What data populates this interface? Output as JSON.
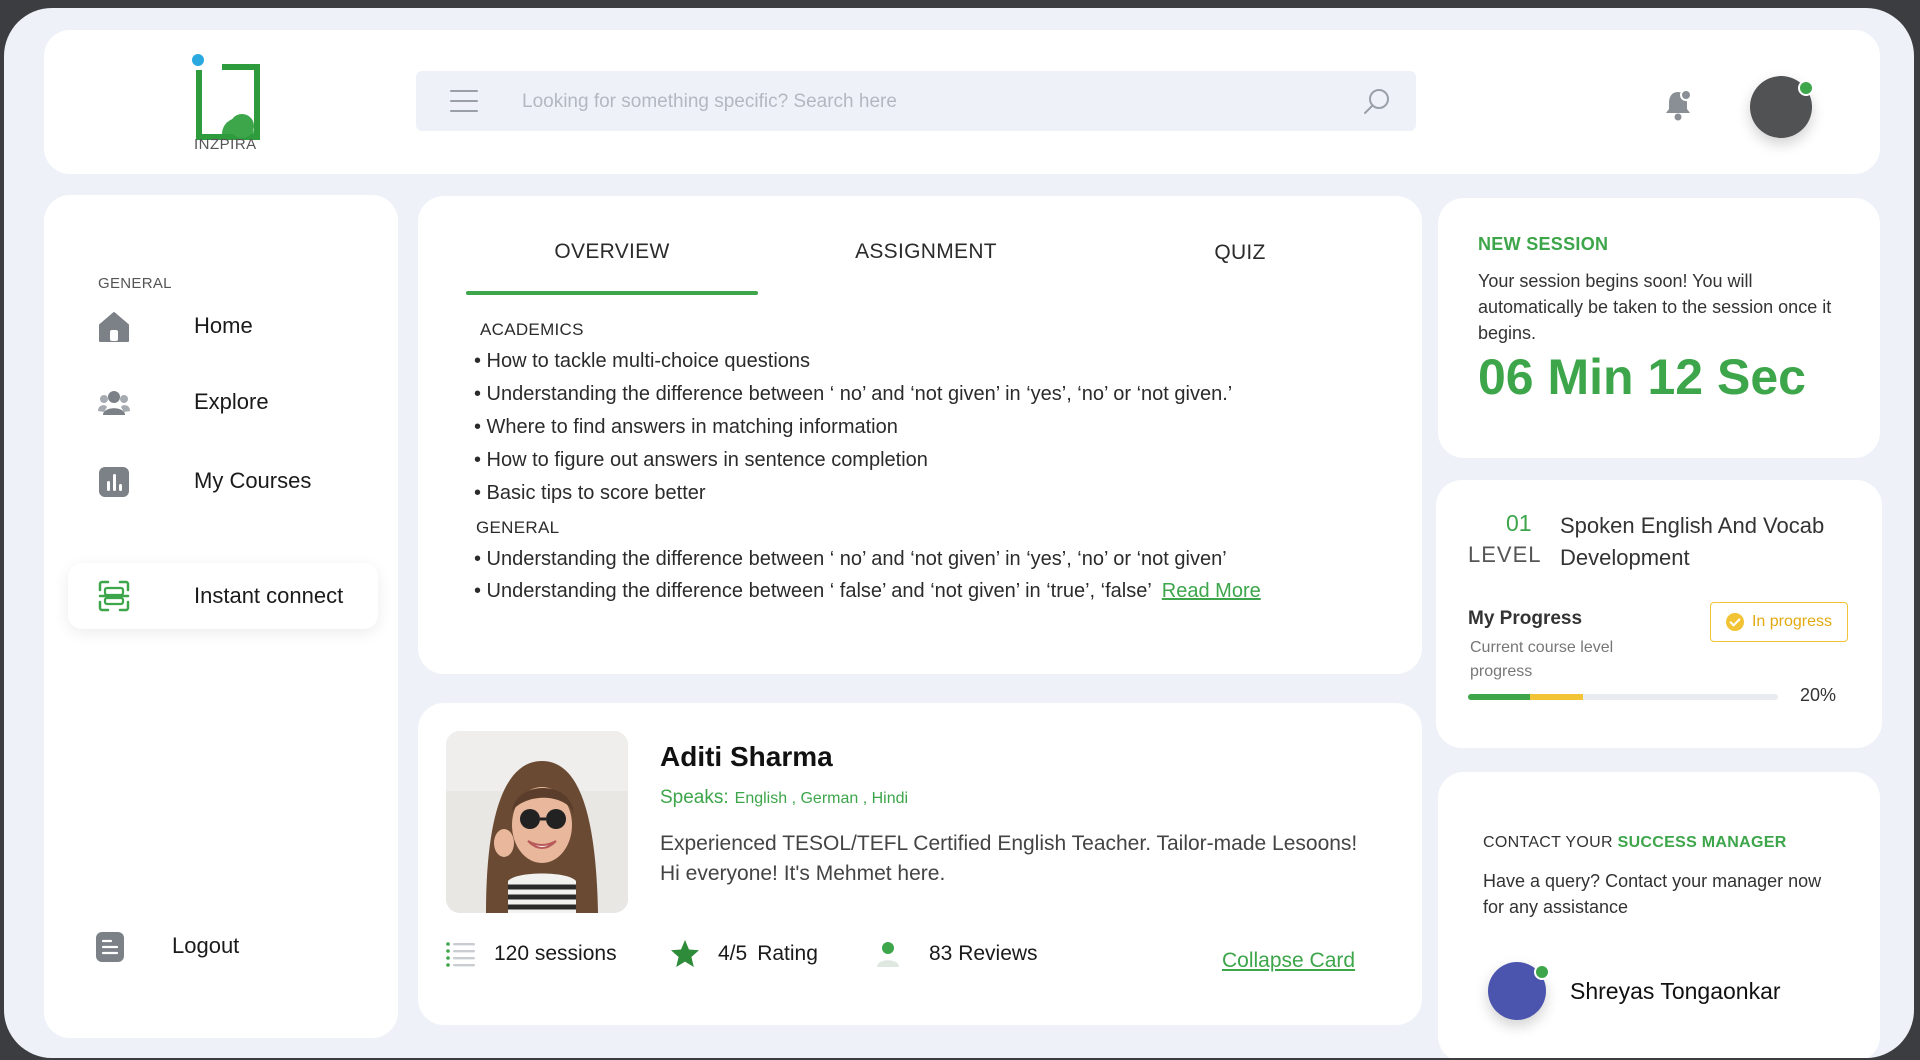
{
  "brand": {
    "name": "INZPIRA",
    "colors": {
      "accent": "#3da54a",
      "warning": "#f2c335",
      "dot": "#2aa8e0"
    }
  },
  "search": {
    "placeholder": "Looking for something specific? Search here",
    "menu_icon": "hamburger-icon",
    "search_icon": "search-icon"
  },
  "header": {
    "bell_icon": "bell-icon"
  },
  "sidebar": {
    "section_label": "GENERAL",
    "items": [
      {
        "label": "Home",
        "icon": "home-icon"
      },
      {
        "label": "Explore",
        "icon": "people-icon"
      },
      {
        "label": "My Courses",
        "icon": "bar-chart-icon"
      },
      {
        "label": "Instant connect",
        "icon": "scan-icon",
        "active": true
      }
    ],
    "logout": {
      "label": "Logout",
      "icon": "document-icon"
    }
  },
  "overview": {
    "tabs": [
      {
        "label": "OVERVIEW",
        "active": true
      },
      {
        "label": "ASSIGNMENT"
      },
      {
        "label": "QUIZ"
      }
    ],
    "sections": [
      {
        "heading": "ACADEMICS",
        "items": [
          "• How to tackle multi-choice questions",
          "• Understanding the difference between ‘ no’ and ‘not given’ in ‘yes’, ‘no’ or ‘not given.’",
          "• Where to find answers in matching information",
          "• How to figure out answers in sentence completion",
          "• Basic tips to score better"
        ]
      },
      {
        "heading": "GENERAL",
        "items": [
          "• Understanding the difference between ‘ no’ and ‘not given’ in ‘yes’, ‘no’ or ‘not given’",
          "• Understanding the difference between ‘ false’ and ‘not given’ in ‘true’, ‘false’"
        ]
      }
    ],
    "read_more": "Read More"
  },
  "teacher": {
    "name": "Aditi Sharma",
    "speaks_label": "Speaks:",
    "languages": "English , German , Hindi",
    "bio": "Experienced TESOL/TEFL Certified English Teacher. Tailor-made Lesoons! Hi everyone! It's Mehmet here.",
    "sessions": "120 sessions",
    "rating": "4/5",
    "rating_label": "Rating",
    "reviews": "83 Reviews",
    "collapse": "Collapse Card"
  },
  "session": {
    "title": "NEW SESSION",
    "body": "Your session begins soon! You will automatically be taken to the session once it begins.",
    "timer": "06 Min 12 Sec"
  },
  "level": {
    "number": "01",
    "label": "LEVEL",
    "title": "Spoken English And Vocab Development",
    "progress_title": "My Progress",
    "progress_sub": "Current course level progress",
    "status": "In progress",
    "percent_text": "20%",
    "progress_green": 0.2,
    "progress_yellow": 0.17
  },
  "contact": {
    "title_prefix": "CONTACT YOUR",
    "title_highlight": "SUCCESS MANAGER",
    "body": "Have a query? Contact your manager now for any assistance",
    "manager_name": "Shreyas Tongaonkar"
  }
}
